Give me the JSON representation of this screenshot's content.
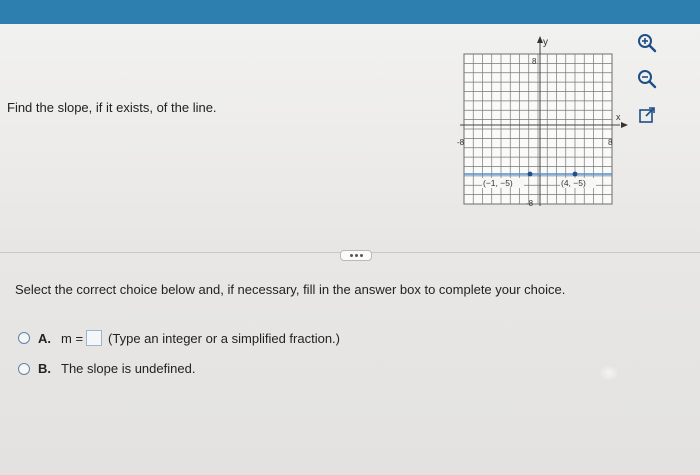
{
  "question": {
    "text": "Find the slope, if it exists, of the line."
  },
  "graph": {
    "y_axis_label": "y",
    "x_axis_label": "x",
    "y_tick_top": "8",
    "y_tick_bottom": "-8",
    "x_tick_left": "-8",
    "x_tick_right": "8",
    "point1_label": "(−1, −5)",
    "point2_label": "(4, −5)",
    "line_color": "#4a90d9",
    "point_color": "#1f4e8c"
  },
  "toolbar": {
    "zoom_in_icon": "zoom-in-icon",
    "zoom_out_icon": "zoom-out-icon",
    "popout_icon": "external-link-icon"
  },
  "more_button": {
    "label": "..."
  },
  "instruction": "Select the correct choice below and, if necessary, fill in the answer box to complete your choice.",
  "choices": [
    {
      "letter": "A.",
      "prefix": "m =",
      "suffix": "(Type an integer or a simplified fraction.)"
    },
    {
      "letter": "B.",
      "text": "The slope is undefined."
    }
  ]
}
